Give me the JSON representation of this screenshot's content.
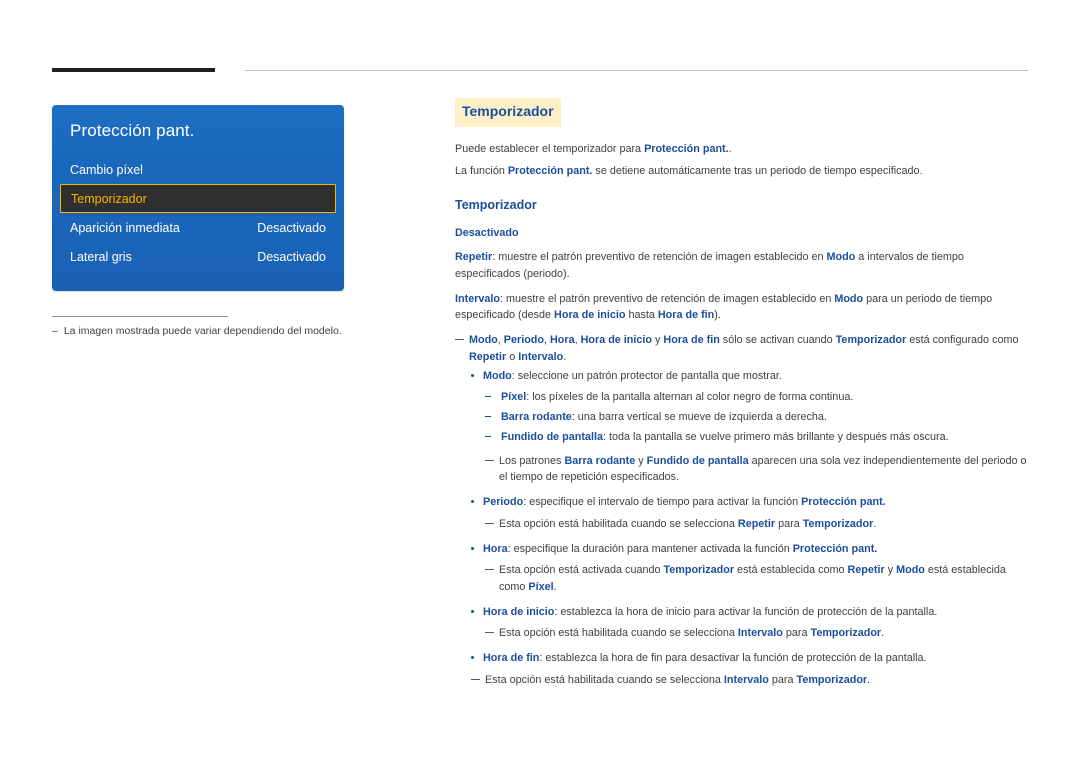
{
  "menu": {
    "title": "Protección pant.",
    "items": [
      {
        "label": "Cambio píxel",
        "value": ""
      },
      {
        "label": "Temporizador",
        "value": "",
        "selected": true
      },
      {
        "label": "Aparición inmediata",
        "value": "Desactivado"
      },
      {
        "label": "Lateral gris",
        "value": "Desactivado"
      }
    ],
    "note_dash": "‒",
    "note": "La imagen mostrada puede variar dependiendo del modelo."
  },
  "content": {
    "heading": "Temporizador",
    "intro_1_a": "Puede establecer el temporizador para ",
    "intro_1_b": "Protección pant.",
    "intro_1_c": ".",
    "intro_2_a": "La función ",
    "intro_2_b": "Protección pant.",
    "intro_2_c": " se detiene automáticamente tras un periodo de tiempo especificado.",
    "subheading": "Temporizador",
    "opt_desactivado": "Desactivado",
    "opt_repetir_label": "Repetir",
    "opt_repetir_a": ": muestre el patrón preventivo de retención de imagen establecido en ",
    "opt_repetir_modo": "Modo",
    "opt_repetir_b": " a intervalos de tiempo especificados (periodo).",
    "opt_intervalo_label": "Intervalo",
    "opt_intervalo_a": ": muestre el patrón preventivo de retención de imagen establecido en ",
    "opt_intervalo_modo": "Modo",
    "opt_intervalo_b": " para un periodo de tiempo especificado (desde ",
    "opt_intervalo_ini": "Hora de inicio",
    "opt_intervalo_c": " hasta ",
    "opt_intervalo_fin": "Hora de fin",
    "opt_intervalo_d": ").",
    "note1_modo": "Modo",
    "note1_sep1": ", ",
    "note1_periodo": "Periodo",
    "note1_sep2": ", ",
    "note1_hora": "Hora",
    "note1_sep3": ", ",
    "note1_horainicio": "Hora de inicio",
    "note1_sep4": " y ",
    "note1_horafin": "Hora de fin",
    "note1_mid": " sólo se activan cuando ",
    "note1_temporizador": "Temporizador",
    "note1_mid2": " está configurado como ",
    "note1_repetir": "Repetir",
    "note1_mid3": " o ",
    "note1_intervalo": "Intervalo",
    "note1_end": ".",
    "b_modo_label": "Modo",
    "b_modo_text": ": seleccione un patrón protector de pantalla que mostrar.",
    "s_pixel_label": "Píxel",
    "s_pixel_text": ": los píxeles de la pantalla alternan al color negro de forma continua.",
    "s_barra_label": "Barra rodante",
    "s_barra_text": ": una barra vertical se mueve de izquierda a derecha.",
    "s_fundido_label": "Fundido de pantalla",
    "s_fundido_text": ": toda la pantalla se vuelve primero más brillante y después más oscura.",
    "note2_a": "Los patrones ",
    "note2_barra": "Barra rodante",
    "note2_b": " y ",
    "note2_fundido": "Fundido de pantalla",
    "note2_c": " aparecen una sola vez independientemente del periodo o el tiempo de repetición especificados.",
    "b_periodo_label": "Periodo",
    "b_periodo_a": ": especifique el intervalo de tiempo para activar la función ",
    "b_periodo_b": "Protección pant.",
    "b_periodo_c": "",
    "note3_a": "Esta opción está habilitada cuando se selecciona ",
    "note3_repetir": "Repetir",
    "note3_b": " para ",
    "note3_temporizador": "Temporizador",
    "note3_c": ".",
    "b_hora_label": "Hora",
    "b_hora_a": ": especifique la duración para mantener activada la función ",
    "b_hora_b": "Protección pant.",
    "note4_a": "Esta opción está activada cuando ",
    "note4_temporizador": "Temporizador",
    "note4_b": " está establecida como ",
    "note4_repetir": "Repetir",
    "note4_c": " y ",
    "note4_modo": "Modo",
    "note4_d": " está establecida como ",
    "note4_pixel": "Píxel",
    "note4_e": ".",
    "b_horainicio_label": "Hora de inicio",
    "b_horainicio_text": ": establezca la hora de inicio para activar la función de protección de la pantalla.",
    "note5_a": "Esta opción está habilitada cuando se selecciona ",
    "note5_intervalo": "Intervalo",
    "note5_b": " para ",
    "note5_temporizador": "Temporizador",
    "note5_c": ".",
    "b_horafin_label": "Hora de fin",
    "b_horafin_text": ": establezca la hora de fin para desactivar la función de protección de la pantalla.",
    "note6_a": "Esta opción está habilitada cuando se selecciona ",
    "note6_intervalo": "Intervalo",
    "note6_b": " para ",
    "note6_temporizador": "Temporizador",
    "note6_c": "."
  }
}
